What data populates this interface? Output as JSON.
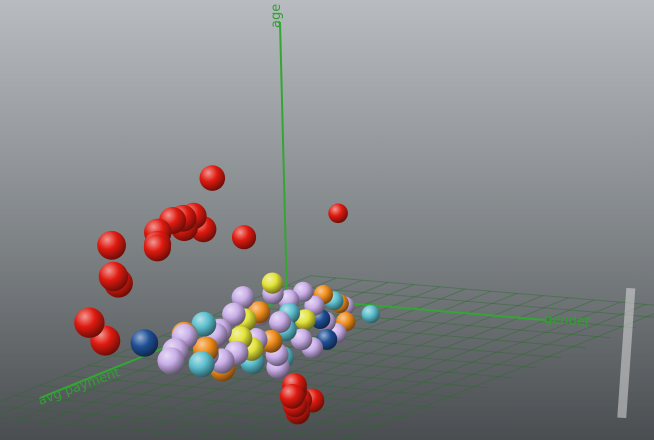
{
  "chart_data": {
    "type": "scatter",
    "title": "",
    "axes": {
      "x": {
        "label": "avg payment"
      },
      "y": {
        "label": "gender"
      },
      "z": {
        "label": "age"
      }
    },
    "grid": true,
    "legend": "none",
    "series": [
      {
        "color": "#e01a10",
        "points": [
          [
            0.22,
            0.42,
            0.42
          ],
          [
            0.7,
            0.4,
            0.72
          ],
          [
            0.9,
            0.48,
            0.62
          ],
          [
            0.8,
            0.42,
            0.62
          ],
          [
            0.78,
            0.36,
            0.6
          ],
          [
            0.72,
            0.38,
            0.54
          ],
          [
            0.76,
            0.3,
            0.58
          ],
          [
            0.8,
            0.28,
            0.55
          ],
          [
            0.62,
            0.44,
            0.48
          ],
          [
            0.74,
            0.22,
            0.48
          ],
          [
            0.7,
            0.18,
            0.45
          ],
          [
            0.9,
            0.2,
            0.42
          ],
          [
            0.86,
            0.18,
            0.38
          ],
          [
            0.78,
            0.08,
            0.48
          ],
          [
            0.98,
            0.18,
            0.28
          ],
          [
            0.98,
            0.24,
            0.22
          ],
          [
            0.92,
            0.98,
            0.04
          ],
          [
            0.97,
            0.98,
            0.06
          ],
          [
            0.99,
            0.98,
            0.05
          ],
          [
            0.99,
            0.97,
            0.08
          ],
          [
            0.98,
            0.98,
            0.02
          ],
          [
            0.99,
            0.99,
            0.03
          ],
          [
            0.99,
            0.98,
            0.1
          ],
          [
            0.99,
            0.98,
            0.12
          ]
        ]
      },
      {
        "color": "#c9aee8",
        "points": [
          [
            0.12,
            0.18,
            0.08
          ],
          [
            0.2,
            0.14,
            0.1
          ],
          [
            0.3,
            0.12,
            0.12
          ],
          [
            0.4,
            0.18,
            0.1
          ],
          [
            0.5,
            0.22,
            0.08
          ],
          [
            0.62,
            0.2,
            0.1
          ],
          [
            0.7,
            0.24,
            0.08
          ],
          [
            0.18,
            0.28,
            0.06
          ],
          [
            0.34,
            0.3,
            0.06
          ],
          [
            0.48,
            0.34,
            0.05
          ],
          [
            0.58,
            0.36,
            0.04
          ],
          [
            0.26,
            0.4,
            0.04
          ],
          [
            0.4,
            0.44,
            0.03
          ],
          [
            0.52,
            0.46,
            0.02
          ],
          [
            0.66,
            0.32,
            0.06
          ],
          [
            0.76,
            0.28,
            0.07
          ],
          [
            0.14,
            0.36,
            0.05
          ],
          [
            0.3,
            0.48,
            0.02
          ],
          [
            0.44,
            0.52,
            0.02
          ],
          [
            0.6,
            0.54,
            0.01
          ],
          [
            0.22,
            0.22,
            0.09
          ],
          [
            0.36,
            0.24,
            0.09
          ],
          [
            0.56,
            0.26,
            0.09
          ],
          [
            0.68,
            0.4,
            0.05
          ]
        ]
      },
      {
        "color": "#e3e33a",
        "points": [
          [
            0.16,
            0.1,
            0.12
          ],
          [
            0.44,
            0.26,
            0.1
          ],
          [
            0.56,
            0.4,
            0.05
          ],
          [
            0.5,
            0.3,
            0.06
          ],
          [
            0.28,
            0.34,
            0.05
          ]
        ]
      },
      {
        "color": "#f08c1a",
        "points": [
          [
            0.06,
            0.2,
            0.05
          ],
          [
            0.2,
            0.42,
            0.02
          ],
          [
            0.32,
            0.2,
            0.08
          ],
          [
            0.46,
            0.38,
            0.04
          ],
          [
            0.58,
            0.16,
            0.09
          ],
          [
            0.72,
            0.44,
            0.04
          ],
          [
            0.64,
            0.3,
            0.07
          ],
          [
            0.1,
            0.3,
            0.04
          ]
        ]
      },
      {
        "color": "#5cbfcf",
        "points": [
          [
            0.08,
            0.26,
            0.04
          ],
          [
            0.12,
            0.44,
            0.02
          ],
          [
            0.26,
            0.26,
            0.06
          ],
          [
            0.38,
            0.36,
            0.05
          ],
          [
            0.48,
            0.14,
            0.09
          ],
          [
            0.62,
            0.46,
            0.03
          ],
          [
            0.54,
            0.5,
            0.02
          ],
          [
            0.72,
            0.36,
            0.05
          ]
        ]
      },
      {
        "color": "#1f4f96",
        "points": [
          [
            0.7,
            0.12,
            0.1
          ],
          [
            0.36,
            0.5,
            0.02
          ],
          [
            0.24,
            0.36,
            0.04
          ]
        ]
      }
    ]
  }
}
